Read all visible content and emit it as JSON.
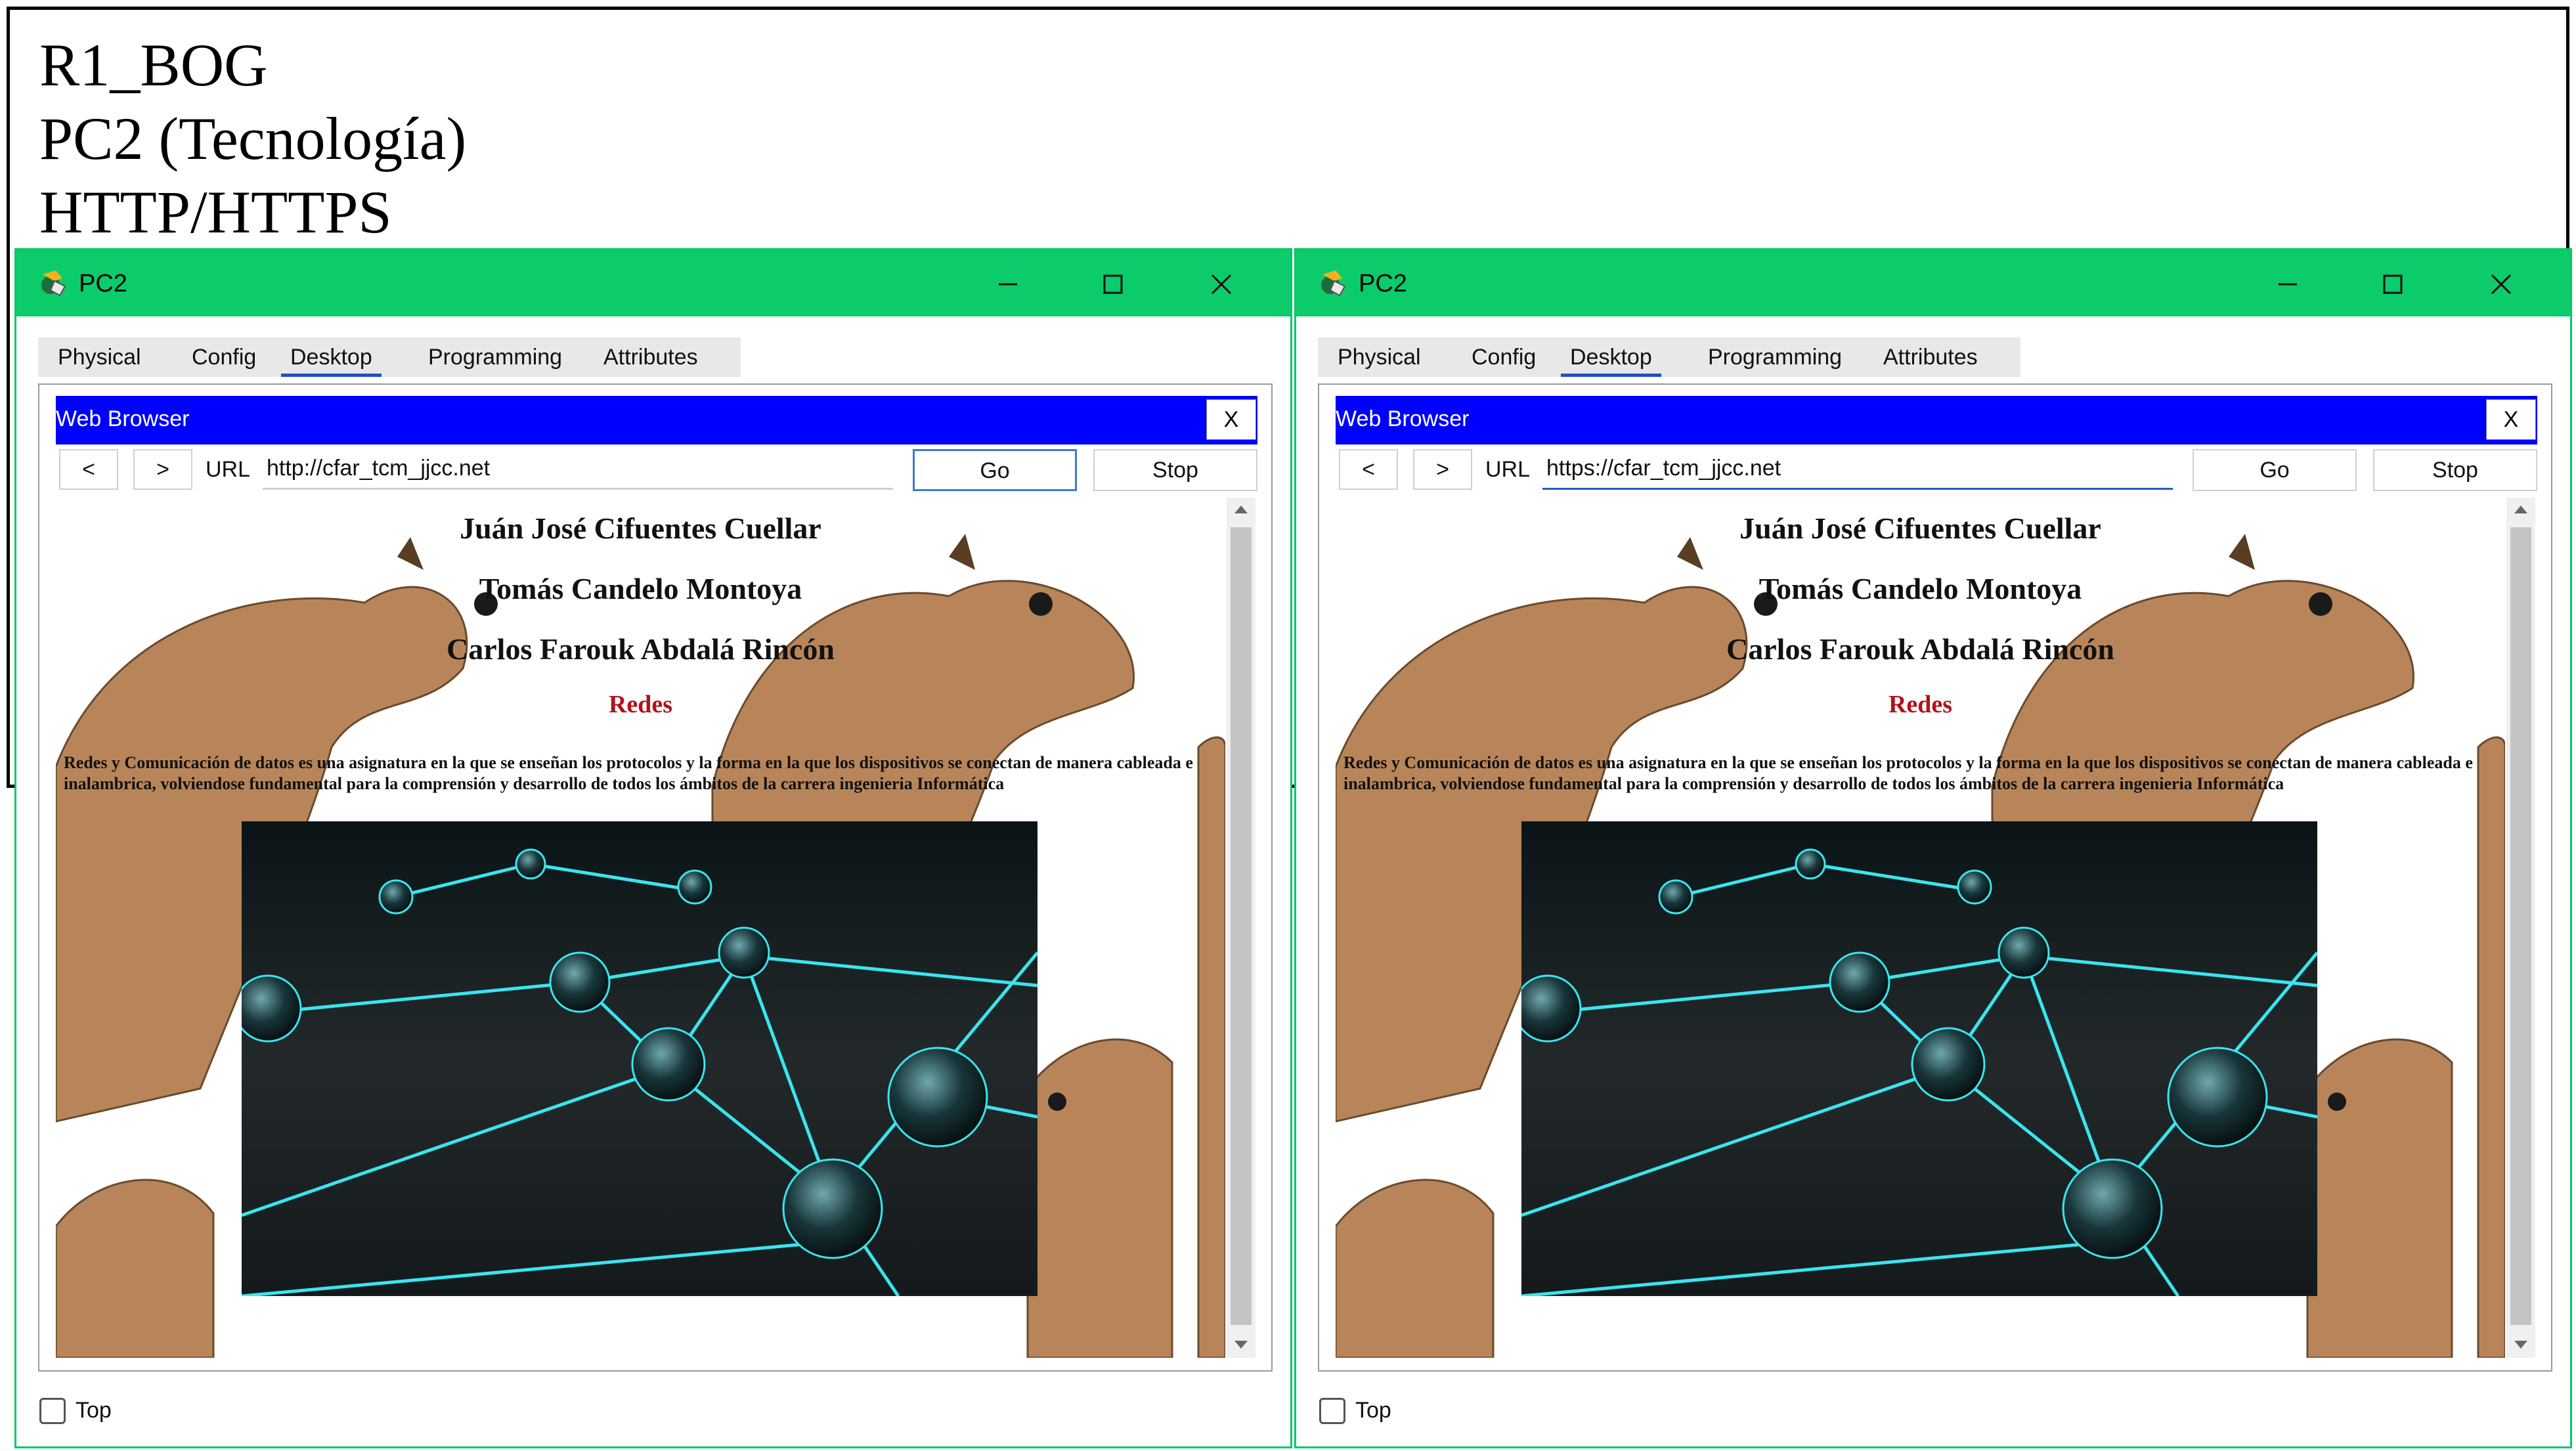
{
  "header": {
    "line1": "R1_BOG",
    "line2": "PC2 (Tecnología)",
    "line3": "HTTP/HTTPS"
  },
  "colors": {
    "titlebar": "#0ccb6b",
    "browser_bar": "#0000ff",
    "active_tab_underline": "#1f4ec9",
    "redes_text": "#b3121b",
    "network_line": "#2fe6ef"
  },
  "windows": [
    {
      "title": "PC2",
      "tabs": [
        "Physical",
        "Config",
        "Desktop",
        "Programming",
        "Attributes"
      ],
      "active_tab": "Desktop",
      "browser": {
        "title": "Web Browser",
        "close_label": "X",
        "back_label": "<",
        "forward_label": ">",
        "url_label": "URL",
        "url_value": "http://cfar_tcm_jjcc.net",
        "go_label": "Go",
        "stop_label": "Stop",
        "focused": "go-button"
      },
      "page": {
        "names": [
          "Juán José Cifuentes Cuellar",
          "Tomás Candelo Montoya",
          "Carlos Farouk Abdalá Rincón"
        ],
        "subject": "Redes",
        "paragraph": "Redes y Comunicación de datos es una asignatura en la que se enseñan los protocolos y la forma en la que los dispositivos se conectan de manera cableada e inalambrica, volviendose fundamental para la comprensión y desarrollo de todos los ámbitos de la carrera ingenieria Informática"
      },
      "top_label": "Top"
    },
    {
      "title": "PC2",
      "tabs": [
        "Physical",
        "Config",
        "Desktop",
        "Programming",
        "Attributes"
      ],
      "active_tab": "Desktop",
      "browser": {
        "title": "Web Browser",
        "close_label": "X",
        "back_label": "<",
        "forward_label": ">",
        "url_label": "URL",
        "url_value": "https://cfar_tcm_jjcc.net",
        "go_label": "Go",
        "stop_label": "Stop",
        "focused": "url-input"
      },
      "page": {
        "names": [
          "Juán José Cifuentes Cuellar",
          "Tomás Candelo Montoya",
          "Carlos Farouk Abdalá Rincón"
        ],
        "subject": "Redes",
        "paragraph": "Redes y Comunicación de datos es una asignatura en la que se enseñan los protocolos y la forma en la que los dispositivos se conectan de manera cableada e inalambrica, volviendose fundamental para la comprensión y desarrollo de todos los ámbitos de la carrera ingenieria Informática"
      },
      "top_label": "Top"
    }
  ]
}
